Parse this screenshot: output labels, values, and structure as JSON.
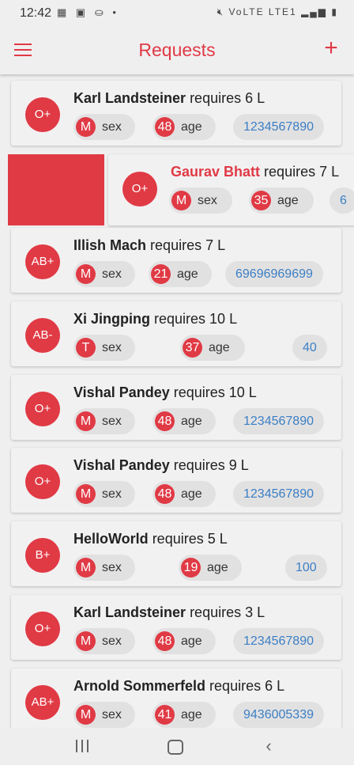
{
  "status_bar": {
    "time": "12:42",
    "left_icons": [
      "calculator-icon",
      "app-badge-icon",
      "incognito-icon",
      "dot-icon"
    ],
    "right_icons": [
      "mute-icon",
      "volte-icon",
      "signal-icon",
      "battery-icon"
    ],
    "network_label": "VoLTE LTE1"
  },
  "header": {
    "title": "Requests",
    "add_symbol": "+"
  },
  "colors": {
    "accent": "#e03a45",
    "phone": "#3b7fc4",
    "chip": "#e2e1e2",
    "background": "#f0eff0"
  },
  "requests": [
    {
      "blood": "O+",
      "name": "Karl Landsteiner",
      "requires": "requires 6 L",
      "sex": "M",
      "sex_label": "sex",
      "age": "48",
      "age_label": "age",
      "phone": "1234567890"
    },
    {
      "blood": "O+",
      "name": "Gaurav Bhatt",
      "requires": "requires 7 L",
      "sex": "M",
      "sex_label": "sex",
      "age": "35",
      "age_label": "age",
      "phone": "6"
    },
    {
      "blood": "AB+",
      "name": "Illish Mach",
      "requires": "requires 7 L",
      "sex": "M",
      "sex_label": "sex",
      "age": "21",
      "age_label": "age",
      "phone": "69696969699"
    },
    {
      "blood": "AB-",
      "name": "Xi Jingping",
      "requires": "requires 10 L",
      "sex": "T",
      "sex_label": "sex",
      "age": "37",
      "age_label": "age",
      "phone": "40"
    },
    {
      "blood": "O+",
      "name": "Vishal Pandey",
      "requires": "requires 10 L",
      "sex": "M",
      "sex_label": "sex",
      "age": "48",
      "age_label": "age",
      "phone": "1234567890"
    },
    {
      "blood": "O+",
      "name": "Vishal Pandey",
      "requires": "requires 9 L",
      "sex": "M",
      "sex_label": "sex",
      "age": "48",
      "age_label": "age",
      "phone": "1234567890"
    },
    {
      "blood": "B+",
      "name": "HelloWorld",
      "requires": "requires 5 L",
      "sex": "M",
      "sex_label": "sex",
      "age": "19",
      "age_label": "age",
      "phone": "100"
    },
    {
      "blood": "O+",
      "name": "Karl Landsteiner",
      "requires": "requires 3 L",
      "sex": "M",
      "sex_label": "sex",
      "age": "48",
      "age_label": "age",
      "phone": "1234567890"
    },
    {
      "blood": "AB+",
      "name": "Arnold Sommerfeld",
      "requires": "requires 6 L",
      "sex": "M",
      "sex_label": "sex",
      "age": "41",
      "age_label": "age",
      "phone": "9436005339"
    }
  ],
  "nav": {
    "recents_icon": "recents-icon",
    "home_icon": "home-icon",
    "back_icon": "back-icon"
  }
}
